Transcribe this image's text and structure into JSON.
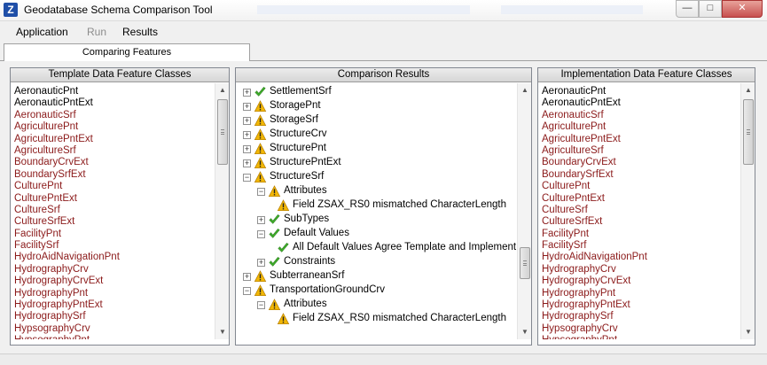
{
  "window": {
    "title": "Geodatabase Schema Comparison Tool",
    "icon_letter": "Z",
    "controls": {
      "minimize": "—",
      "maximize": "□",
      "close": "✕"
    }
  },
  "menu": [
    "Application",
    "Run",
    "Results"
  ],
  "tab": {
    "label": "Comparing Features"
  },
  "template_panel": {
    "header": "Template Data Feature Classes",
    "items": [
      {
        "label": "AeronauticPnt",
        "color": "black"
      },
      {
        "label": "AeronauticPntExt",
        "color": "black"
      },
      {
        "label": "AeronauticSrf",
        "color": "red"
      },
      {
        "label": "AgriculturePnt",
        "color": "red"
      },
      {
        "label": "AgriculturePntExt",
        "color": "red"
      },
      {
        "label": "AgricultureSrf",
        "color": "red"
      },
      {
        "label": "BoundaryCrvExt",
        "color": "red"
      },
      {
        "label": "BoundarySrfExt",
        "color": "red"
      },
      {
        "label": "CulturePnt",
        "color": "red"
      },
      {
        "label": "CulturePntExt",
        "color": "red"
      },
      {
        "label": "CultureSrf",
        "color": "red"
      },
      {
        "label": "CultureSrfExt",
        "color": "red"
      },
      {
        "label": "FacilityPnt",
        "color": "red"
      },
      {
        "label": "FacilitySrf",
        "color": "red"
      },
      {
        "label": "HydroAidNavigationPnt",
        "color": "red"
      },
      {
        "label": "HydrographyCrv",
        "color": "red"
      },
      {
        "label": "HydrographyCrvExt",
        "color": "red"
      },
      {
        "label": "HydrographyPnt",
        "color": "red"
      },
      {
        "label": "HydrographyPntExt",
        "color": "red"
      },
      {
        "label": "HydrographySrf",
        "color": "red"
      },
      {
        "label": "HypsographyCrv",
        "color": "red"
      },
      {
        "label": "HypsographyPnt",
        "color": "red"
      }
    ]
  },
  "comparison_panel": {
    "header": "Comparison Results",
    "nodes": [
      {
        "level": 0,
        "expander": "+",
        "status": "ok",
        "label": "SettlementSrf"
      },
      {
        "level": 0,
        "expander": "+",
        "status": "warn",
        "label": "StoragePnt"
      },
      {
        "level": 0,
        "expander": "+",
        "status": "warn",
        "label": "StorageSrf"
      },
      {
        "level": 0,
        "expander": "+",
        "status": "warn",
        "label": "StructureCrv"
      },
      {
        "level": 0,
        "expander": "+",
        "status": "warn",
        "label": "StructurePnt"
      },
      {
        "level": 0,
        "expander": "+",
        "status": "warn",
        "label": "StructurePntExt"
      },
      {
        "level": 0,
        "expander": "−",
        "status": "warn",
        "label": "StructureSrf"
      },
      {
        "level": 1,
        "expander": "−",
        "status": "warn",
        "label": "Attributes"
      },
      {
        "level": 2,
        "expander": "",
        "status": "warn",
        "label": "Field ZSAX_RS0 mismatched CharacterLength"
      },
      {
        "level": 1,
        "expander": "+",
        "status": "ok",
        "label": "SubTypes"
      },
      {
        "level": 1,
        "expander": "−",
        "status": "ok",
        "label": "Default Values"
      },
      {
        "level": 2,
        "expander": "",
        "status": "ok",
        "label": "All Default Values Agree Template and Implement"
      },
      {
        "level": 1,
        "expander": "+",
        "status": "ok",
        "label": "Constraints"
      },
      {
        "level": 0,
        "expander": "+",
        "status": "warn",
        "label": "SubterraneanSrf"
      },
      {
        "level": 0,
        "expander": "−",
        "status": "warn",
        "label": "TransportationGroundCrv"
      },
      {
        "level": 1,
        "expander": "−",
        "status": "warn",
        "label": "Attributes"
      },
      {
        "level": 2,
        "expander": "",
        "status": "warn",
        "label": "Field ZSAX_RS0 mismatched CharacterLength"
      }
    ]
  },
  "implementation_panel": {
    "header": "Implementation Data Feature Classes",
    "items": [
      {
        "label": "AeronauticPnt",
        "color": "black"
      },
      {
        "label": "AeronauticPntExt",
        "color": "black"
      },
      {
        "label": "AeronauticSrf",
        "color": "red"
      },
      {
        "label": "AgriculturePnt",
        "color": "red"
      },
      {
        "label": "AgriculturePntExt",
        "color": "red"
      },
      {
        "label": "AgricultureSrf",
        "color": "red"
      },
      {
        "label": "BoundaryCrvExt",
        "color": "red"
      },
      {
        "label": "BoundarySrfExt",
        "color": "red"
      },
      {
        "label": "CulturePnt",
        "color": "red"
      },
      {
        "label": "CulturePntExt",
        "color": "red"
      },
      {
        "label": "CultureSrf",
        "color": "red"
      },
      {
        "label": "CultureSrfExt",
        "color": "red"
      },
      {
        "label": "FacilityPnt",
        "color": "red"
      },
      {
        "label": "FacilitySrf",
        "color": "red"
      },
      {
        "label": "HydroAidNavigationPnt",
        "color": "red"
      },
      {
        "label": "HydrographyCrv",
        "color": "red"
      },
      {
        "label": "HydrographyCrvExt",
        "color": "red"
      },
      {
        "label": "HydrographyPnt",
        "color": "red"
      },
      {
        "label": "HydrographyPntExt",
        "color": "red"
      },
      {
        "label": "HydrographySrf",
        "color": "red"
      },
      {
        "label": "HypsographyCrv",
        "color": "red"
      },
      {
        "label": "HypsographyPnt",
        "color": "red"
      }
    ]
  },
  "colors": {
    "mismatch_text": "#8b1a1a",
    "match_text": "#000000",
    "ok_icon": "#3fae2a",
    "warn_icon": "#f2b705"
  },
  "icons": {
    "ok": "green-check-icon",
    "warn": "warning-triangle-icon"
  }
}
